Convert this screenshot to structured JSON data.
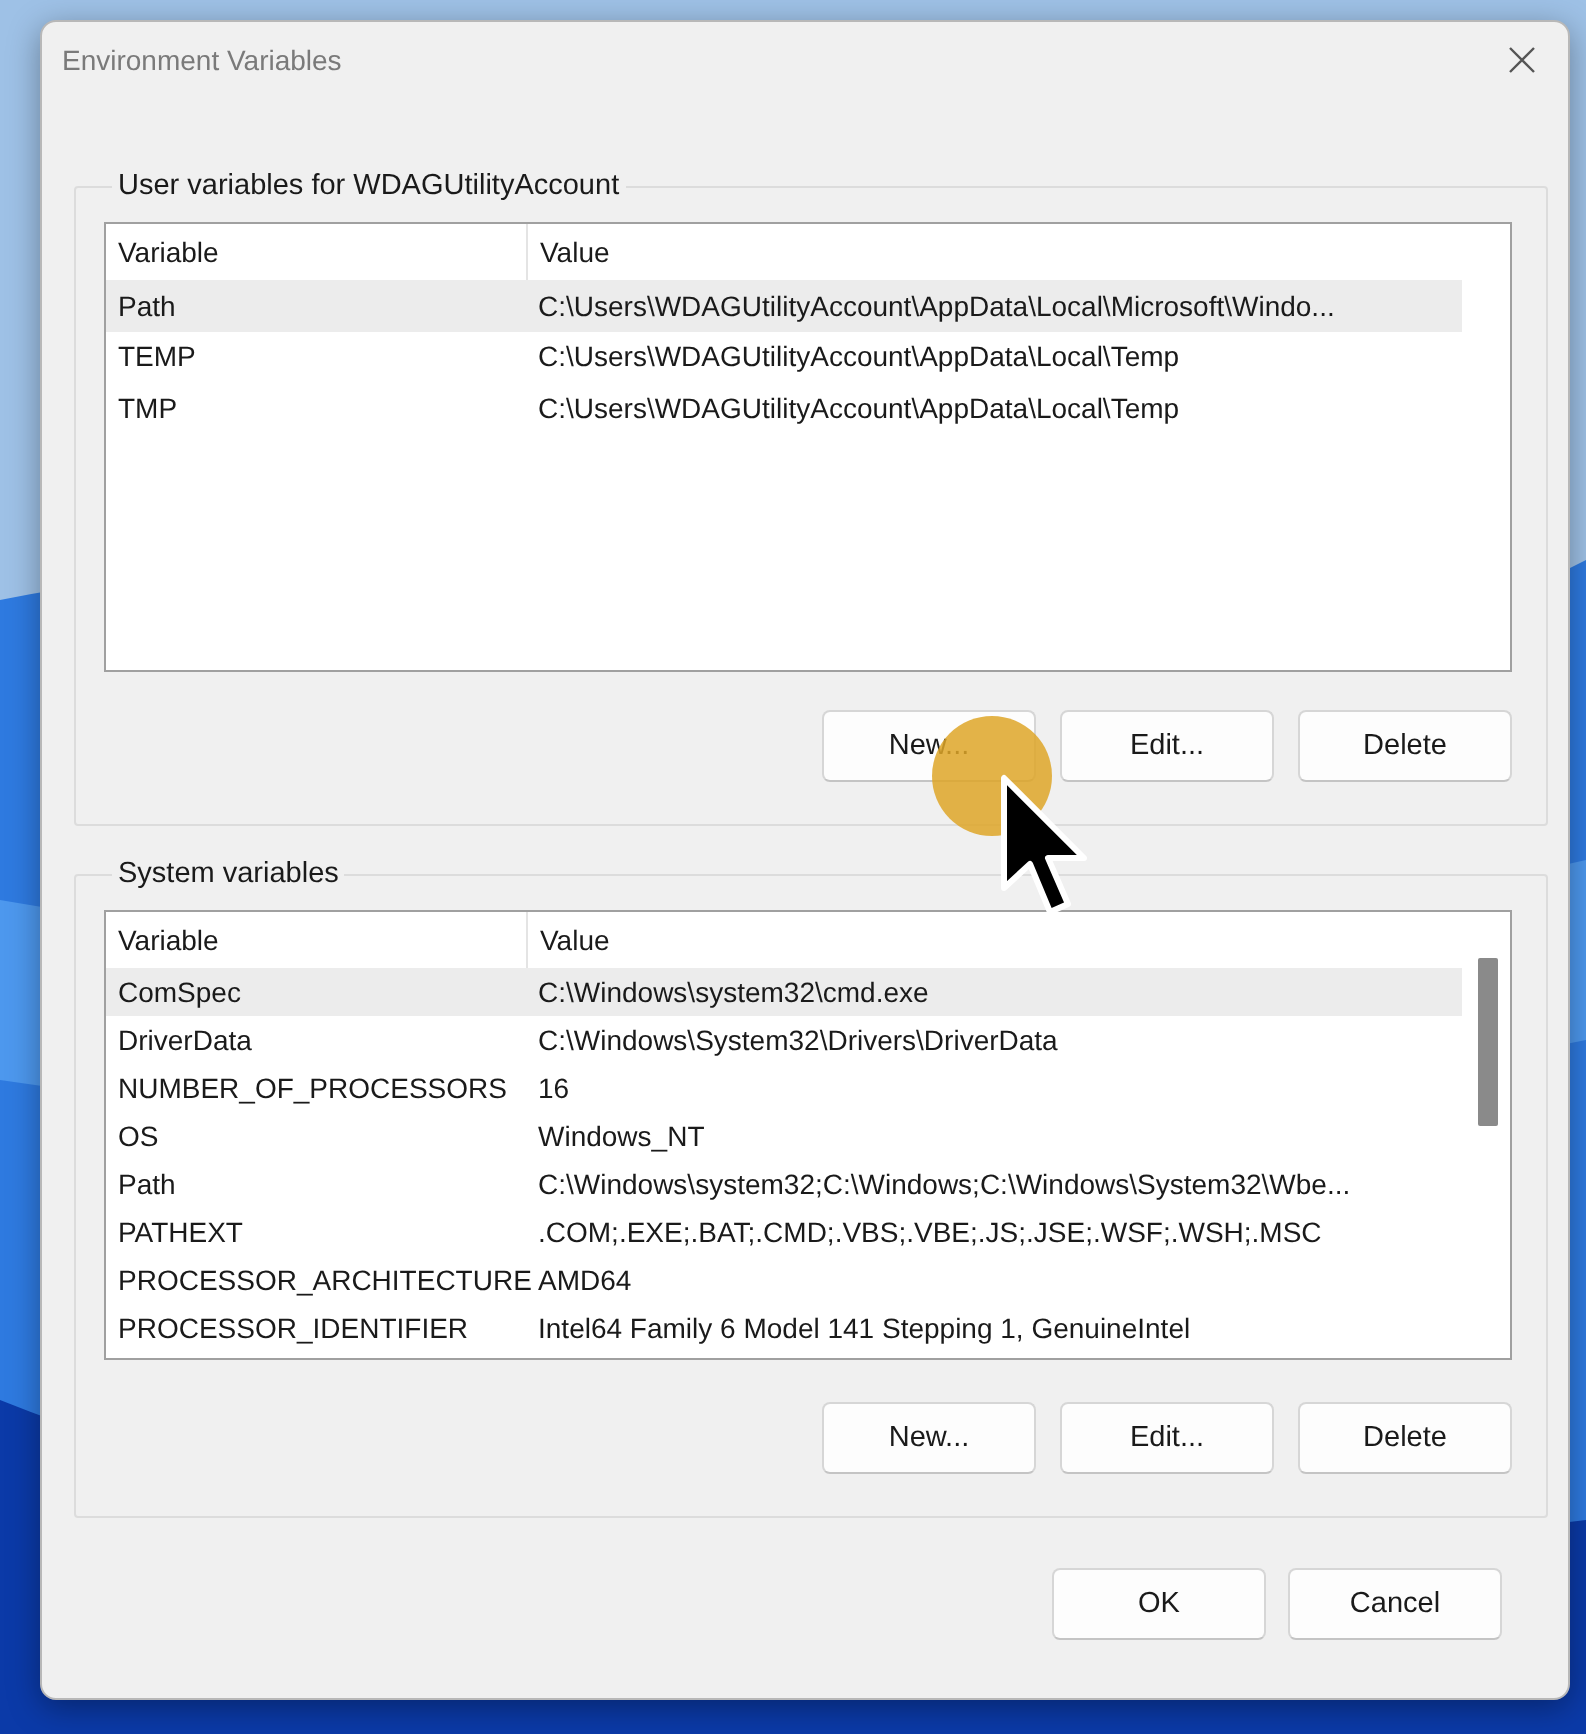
{
  "window": {
    "title": "Environment Variables"
  },
  "user_variables": {
    "title": "User variables for WDAGUtilityAccount",
    "columns": [
      "Variable",
      "Value"
    ],
    "rows": [
      {
        "variable": "Path",
        "value": "C:\\Users\\WDAGUtilityAccount\\AppData\\Local\\Microsoft\\Windo...",
        "selected": true
      },
      {
        "variable": "TEMP",
        "value": "C:\\Users\\WDAGUtilityAccount\\AppData\\Local\\Temp",
        "selected": false
      },
      {
        "variable": "TMP",
        "value": "C:\\Users\\WDAGUtilityAccount\\AppData\\Local\\Temp",
        "selected": false
      }
    ],
    "buttons": [
      "New...",
      "Edit...",
      "Delete"
    ]
  },
  "system_variables": {
    "title": "System variables",
    "columns": [
      "Variable",
      "Value"
    ],
    "rows": [
      {
        "variable": "ComSpec",
        "value": "C:\\Windows\\system32\\cmd.exe",
        "selected": true
      },
      {
        "variable": "DriverData",
        "value": "C:\\Windows\\System32\\Drivers\\DriverData",
        "selected": false
      },
      {
        "variable": "NUMBER_OF_PROCESSORS",
        "value": "16",
        "selected": false
      },
      {
        "variable": "OS",
        "value": "Windows_NT",
        "selected": false
      },
      {
        "variable": "Path",
        "value": "C:\\Windows\\system32;C:\\Windows;C:\\Windows\\System32\\Wbe...",
        "selected": false
      },
      {
        "variable": "PATHEXT",
        "value": ".COM;.EXE;.BAT;.CMD;.VBS;.VBE;.JS;.JSE;.WSF;.WSH;.MSC",
        "selected": false
      },
      {
        "variable": "PROCESSOR_ARCHITECTURE",
        "value": "AMD64",
        "selected": false
      },
      {
        "variable": "PROCESSOR_IDENTIFIER",
        "value": "Intel64 Family 6 Model 141 Stepping 1, GenuineIntel",
        "selected": false
      }
    ],
    "buttons": [
      "New...",
      "Edit...",
      "Delete"
    ]
  },
  "buttons": [
    "OK",
    "Cancel"
  ]
}
